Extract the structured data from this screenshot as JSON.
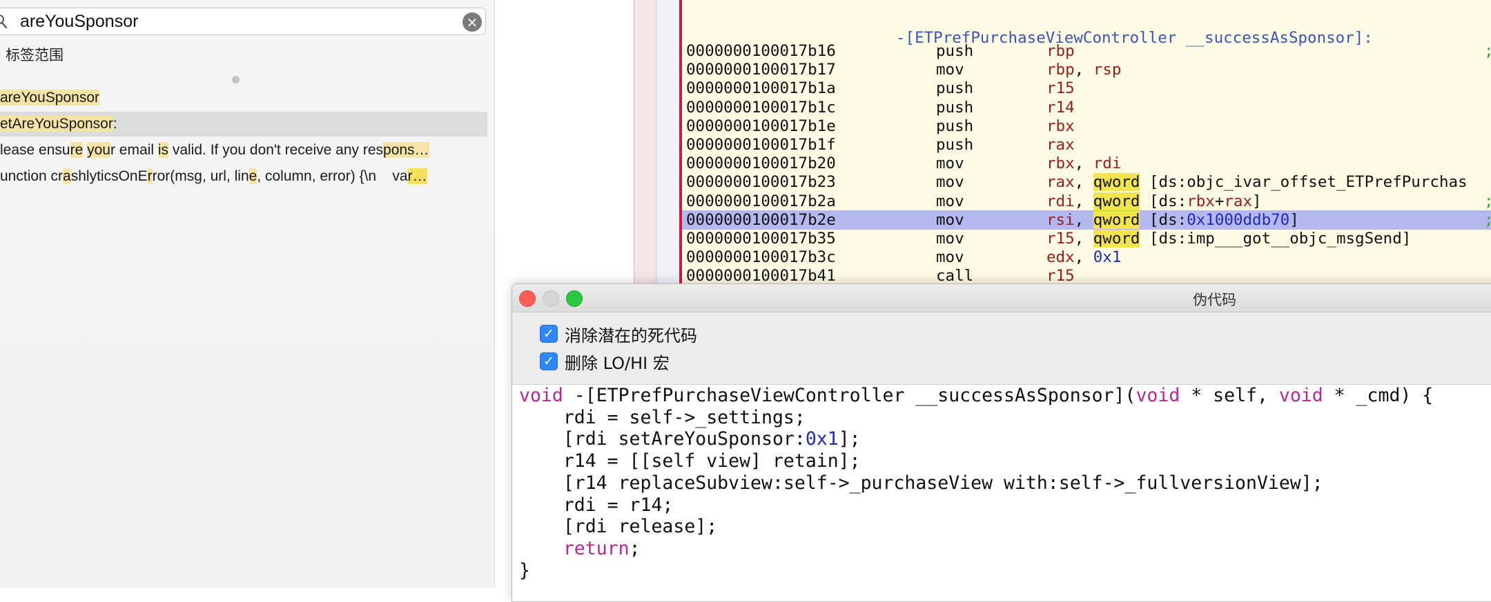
{
  "search": {
    "query": "areYouSponsor",
    "clear_icon": "×",
    "scope_label": "标签范围"
  },
  "results": [
    {
      "pre": "",
      "hl": "areYouSponsor",
      "post": ""
    },
    {
      "pre": "",
      "hl": "etAreYouSponsor",
      "post": ":"
    },
    {
      "text": "lease ensure your email is valid. If you don't receive any respons…"
    },
    {
      "text": "unction crashlyticsOnError(msg, url, line, column, error) {\\n    var…"
    }
  ],
  "disassembly": {
    "title": "-[ETPrefPurchaseViewController __successAsSponsor]:",
    "lines": [
      {
        "addr": "0000000100017b16",
        "mn": "push",
        "ops": "rbp",
        "semi": ";"
      },
      {
        "addr": "0000000100017b17",
        "mn": "mov",
        "ops": "rbp, rsp",
        "semi": ""
      },
      {
        "addr": "0000000100017b1a",
        "mn": "push",
        "ops": "r15",
        "semi": ""
      },
      {
        "addr": "0000000100017b1c",
        "mn": "push",
        "ops": "r14",
        "semi": ""
      },
      {
        "addr": "0000000100017b1e",
        "mn": "push",
        "ops": "rbx",
        "semi": ""
      },
      {
        "addr": "0000000100017b1f",
        "mn": "push",
        "ops": "rax",
        "semi": ""
      },
      {
        "addr": "0000000100017b20",
        "mn": "mov",
        "ops": "rbx, rdi",
        "semi": ""
      },
      {
        "addr": "0000000100017b23",
        "mn": "mov",
        "ops": "rax, qword [ds:objc_ivar_offset_ETPrefPurchas",
        "semi": ""
      },
      {
        "addr": "0000000100017b2a",
        "mn": "mov",
        "ops": "rdi, qword [ds:rbx+rax]",
        "semi": ";"
      },
      {
        "addr": "0000000100017b2e",
        "mn": "mov",
        "ops": "rsi, qword [ds:0x1000ddb70]",
        "semi": ";",
        "selected": true
      },
      {
        "addr": "0000000100017b35",
        "mn": "mov",
        "ops": "r15, qword [ds:imp___got__objc_msgSend]",
        "semi": ""
      },
      {
        "addr": "0000000100017b3c",
        "mn": "mov",
        "ops": "edx, 0x1",
        "semi": ""
      },
      {
        "addr": "0000000100017b41",
        "mn": "call",
        "ops": "r15",
        "semi": ""
      }
    ]
  },
  "pseudocode": {
    "title": "伪代码",
    "options": [
      {
        "label": "消除潜在的死代码",
        "checked": true
      },
      {
        "label": "删除 LO/HI 宏",
        "checked": true
      }
    ],
    "code": [
      "void -[ETPrefPurchaseViewController __successAsSponsor](void * self, void * _cmd) {",
      "    rdi = self->_settings;",
      "    [rdi setAreYouSponsor:0x1];",
      "    r14 = [[self view] retain];",
      "    [r14 replaceSubview:self->_purchaseView with:self->_fullversionView];",
      "    rdi = r14;",
      "    [rdi release];",
      "    return;",
      "}"
    ],
    "check_icon": "✓"
  },
  "colors": {
    "accent": "#2f86f7",
    "selection": "#b5b7ef",
    "keyword_highlight": "#f2e54b",
    "register": "#9a1c1c",
    "number": "#1f2bb8",
    "c_keyword": "#b8259a"
  }
}
